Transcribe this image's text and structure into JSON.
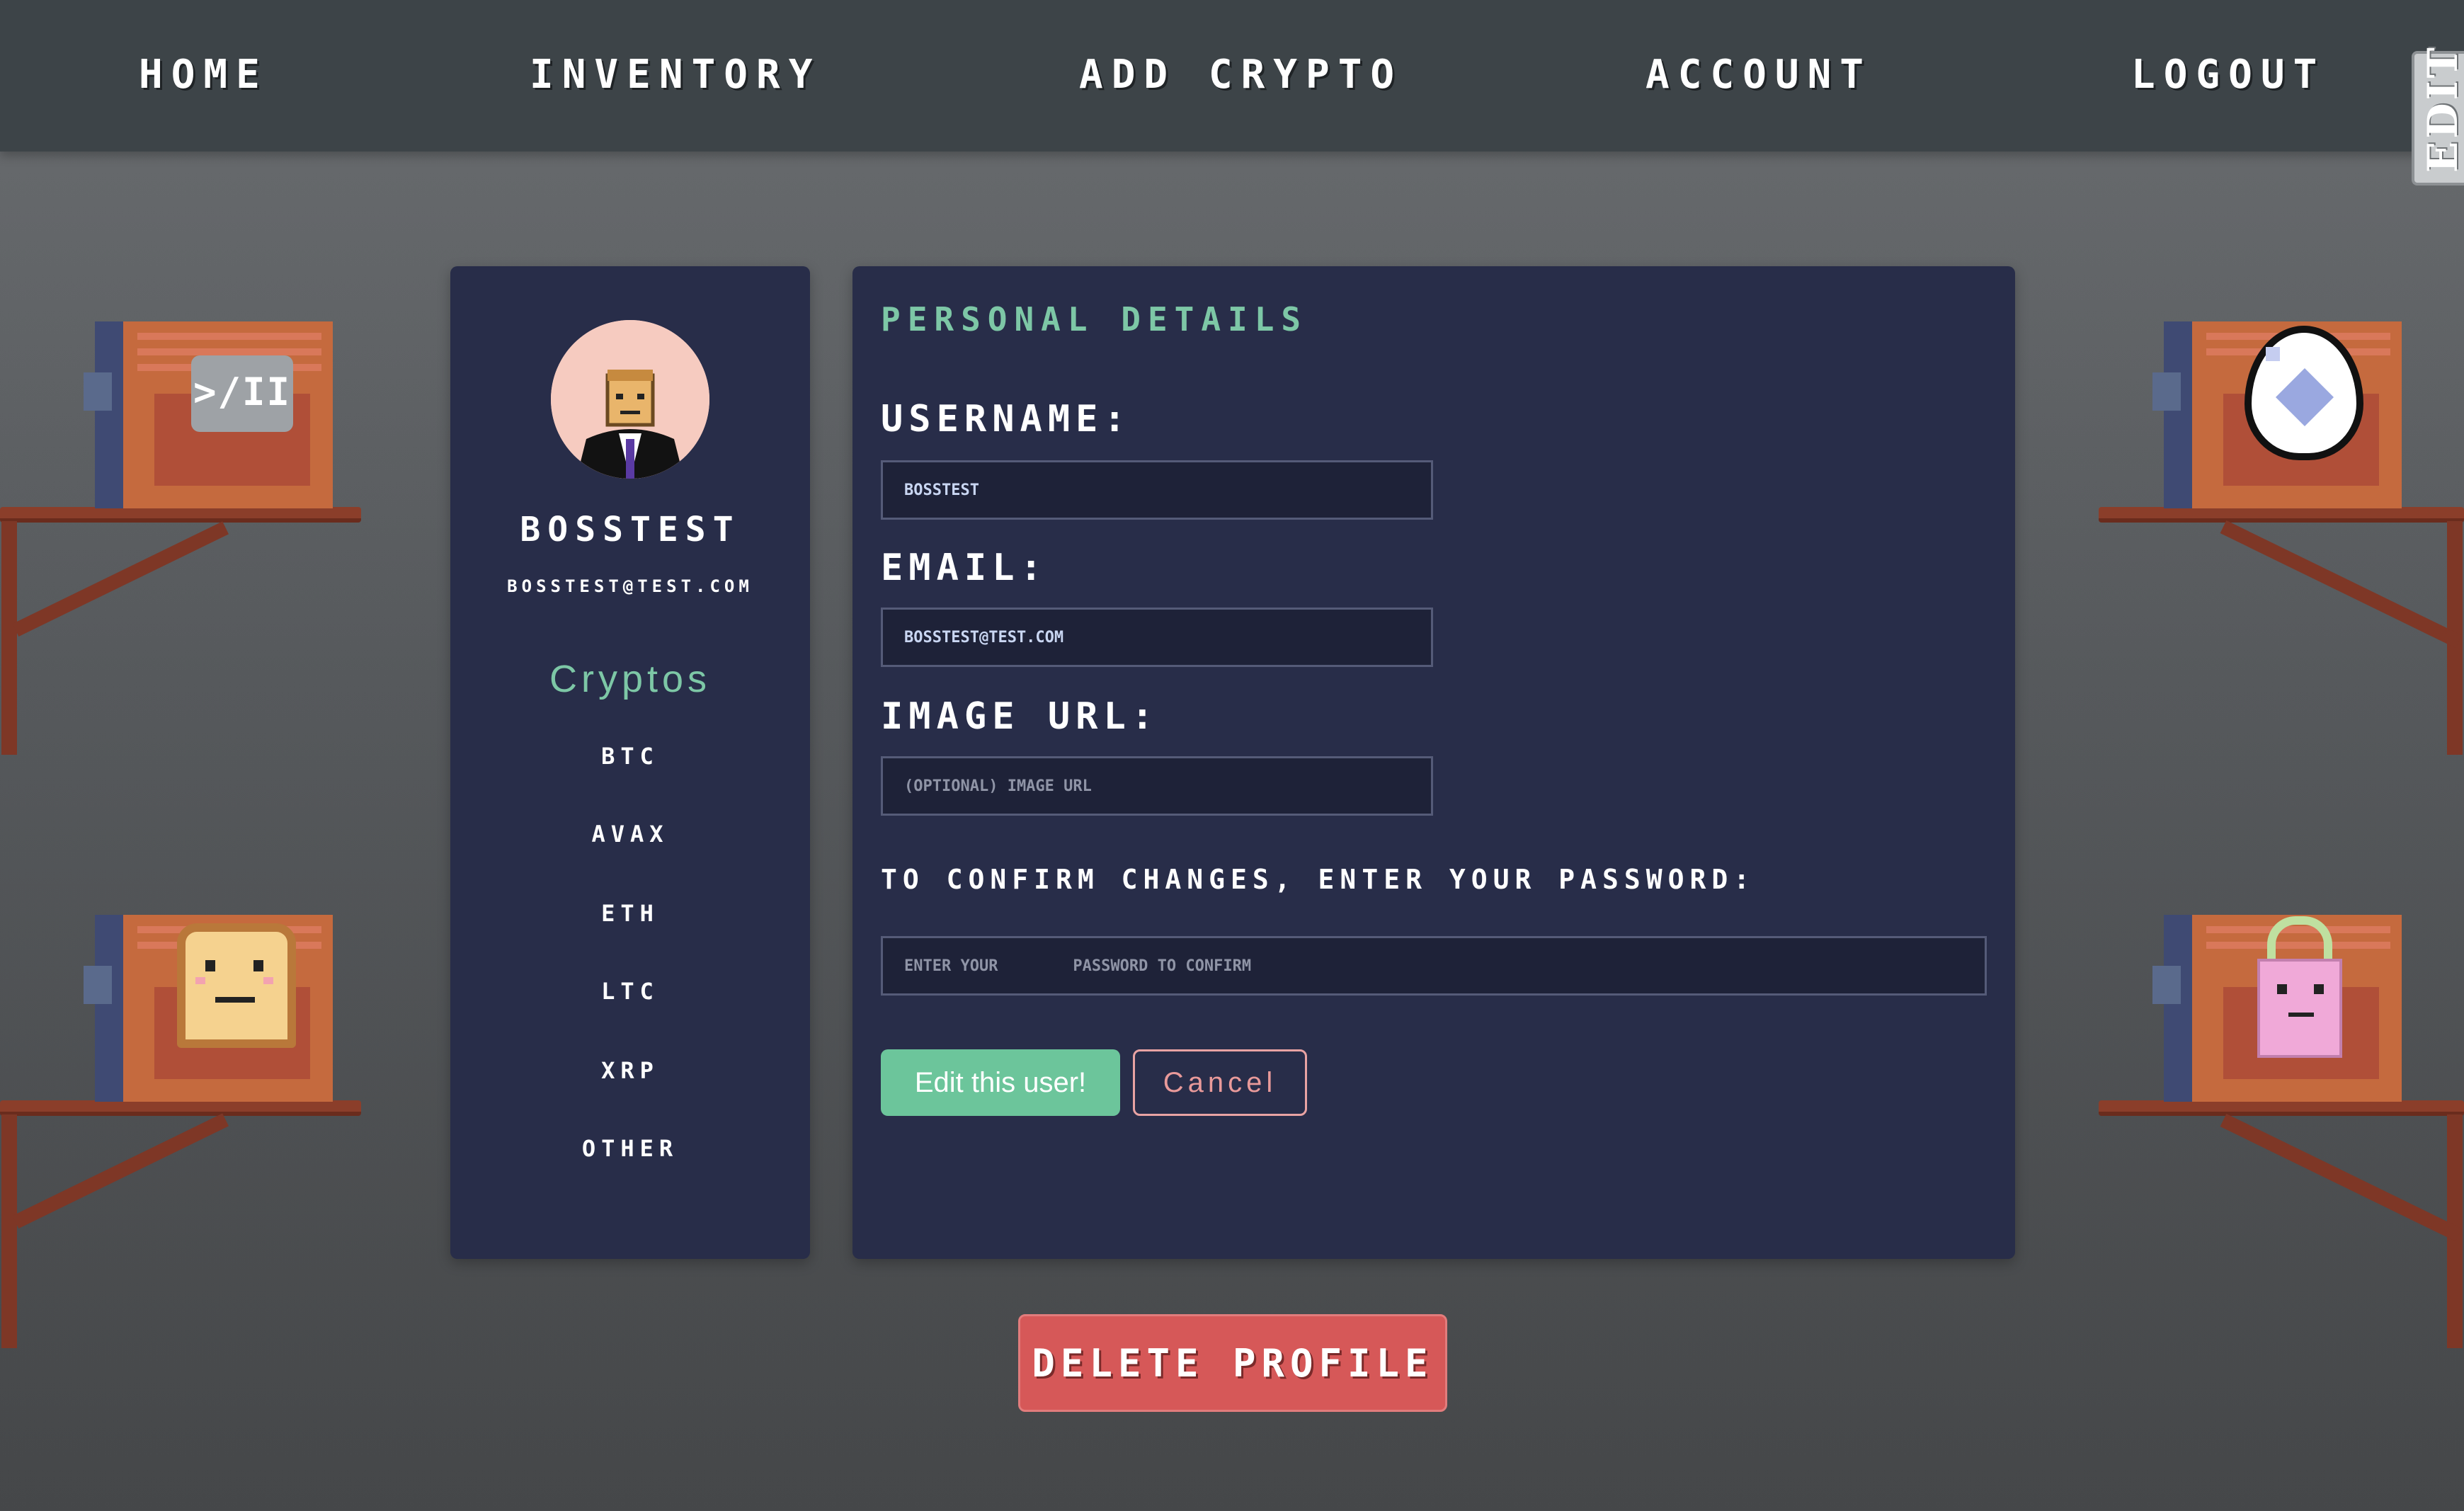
{
  "nav": {
    "items": [
      "HOME",
      "INVENTORY",
      "ADD CRYPTO",
      "ACCOUNT",
      "LOGOUT"
    ],
    "edit_tab": "EDIT"
  },
  "profile": {
    "username": "BOSSTEST",
    "email": "BOSSTEST@TEST.COM",
    "cryptos_heading": "Cryptos",
    "cryptos": [
      "BTC",
      "AVAX",
      "ETH",
      "LTC",
      "XRP",
      "OTHER"
    ]
  },
  "details": {
    "title": "PERSONAL DETAILS",
    "username_label": "USERNAME:",
    "username_value": "BOSSTEST",
    "email_label": "EMAIL:",
    "email_value": "BOSSTEST@TEST.COM",
    "image_label": "IMAGE URL:",
    "image_placeholder": "(OPTIONAL) IMAGE URL",
    "confirm_label": "TO CONFIRM CHANGES, ENTER YOUR PASSWORD:",
    "password_placeholder": "ENTER YOUR        PASSWORD TO CONFIRM",
    "edit_button": "Edit this user!",
    "cancel_button": "Cancel"
  },
  "delete_button": "DELETE PROFILE",
  "decor": {
    "top_left_icon_text": ">/II"
  },
  "colors": {
    "nav_bg": "#3d4448",
    "panel_bg": "#282d49",
    "accent_green": "#7dc7a6",
    "button_green": "#6cc59b",
    "cancel_pink": "#e99a9a",
    "delete_red": "#d65858"
  }
}
